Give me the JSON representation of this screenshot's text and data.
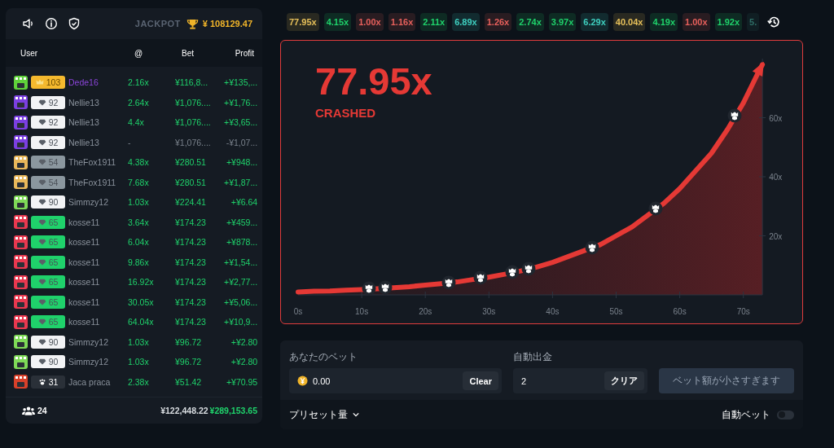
{
  "header": {
    "jackpot_label": "JACKPOT",
    "jackpot_amount": "¥ 108129.47"
  },
  "table": {
    "columns": [
      "User",
      "@",
      "Bet",
      "Profit"
    ],
    "rows": [
      {
        "avatar": {
          "color": "#5fd13a"
        },
        "badge": {
          "kind": "crown",
          "color": "#f5b92e",
          "level": "103"
        },
        "user": "Dede16",
        "highlight": true,
        "cashed_out": true,
        "at": "2.16x",
        "bet": "¥116,8...",
        "profit": "+¥135,..."
      },
      {
        "avatar": {
          "color": "#7b3fe0"
        },
        "badge": {
          "kind": "diamond",
          "color": "#f2f3f5",
          "level": "92"
        },
        "user": "Nellie13",
        "highlight": false,
        "cashed_out": true,
        "at": "2.64x",
        "bet": "¥1,076....",
        "profit": "+¥1,76..."
      },
      {
        "avatar": {
          "color": "#7b3fe0"
        },
        "badge": {
          "kind": "diamond",
          "color": "#f2f3f5",
          "level": "92"
        },
        "user": "Nellie13",
        "highlight": false,
        "cashed_out": true,
        "at": "4.4x",
        "bet": "¥1,076....",
        "profit": "+¥3,65..."
      },
      {
        "avatar": {
          "color": "#7b3fe0"
        },
        "badge": {
          "kind": "diamond",
          "color": "#f2f3f5",
          "level": "92"
        },
        "user": "Nellie13",
        "highlight": false,
        "cashed_out": false,
        "at": "-",
        "bet": "¥1,076....",
        "profit": "-¥1,07..."
      },
      {
        "avatar": {
          "color": "#e8b75a"
        },
        "badge": {
          "kind": "diamond",
          "color": "#8b979f",
          "level": "54"
        },
        "user": "TheFox1911",
        "highlight": false,
        "cashed_out": true,
        "at": "4.38x",
        "bet": "¥280.51",
        "profit": "+¥948..."
      },
      {
        "avatar": {
          "color": "#e8b75a"
        },
        "badge": {
          "kind": "diamond",
          "color": "#8b979f",
          "level": "54"
        },
        "user": "TheFox1911",
        "highlight": false,
        "cashed_out": true,
        "at": "7.68x",
        "bet": "¥280.51",
        "profit": "+¥1,87..."
      },
      {
        "avatar": {
          "color": "#7ed957"
        },
        "badge": {
          "kind": "diamond",
          "color": "#f2f3f5",
          "level": "90"
        },
        "user": "Simmzy12",
        "highlight": false,
        "cashed_out": true,
        "at": "1.03x",
        "bet": "¥224.41",
        "profit": "+¥6.64"
      },
      {
        "avatar": {
          "color": "#e8384f"
        },
        "badge": {
          "kind": "diamond",
          "color": "#1fd26b",
          "level": "65"
        },
        "user": "kosse11",
        "highlight": false,
        "cashed_out": true,
        "at": "3.64x",
        "bet": "¥174.23",
        "profit": "+¥459..."
      },
      {
        "avatar": {
          "color": "#e8384f"
        },
        "badge": {
          "kind": "diamond",
          "color": "#1fd26b",
          "level": "65"
        },
        "user": "kosse11",
        "highlight": false,
        "cashed_out": true,
        "at": "6.04x",
        "bet": "¥174.23",
        "profit": "+¥878..."
      },
      {
        "avatar": {
          "color": "#e8384f"
        },
        "badge": {
          "kind": "diamond",
          "color": "#1fd26b",
          "level": "65"
        },
        "user": "kosse11",
        "highlight": false,
        "cashed_out": true,
        "at": "9.86x",
        "bet": "¥174.23",
        "profit": "+¥1,54..."
      },
      {
        "avatar": {
          "color": "#e8384f"
        },
        "badge": {
          "kind": "diamond",
          "color": "#1fd26b",
          "level": "65"
        },
        "user": "kosse11",
        "highlight": false,
        "cashed_out": true,
        "at": "16.92x",
        "bet": "¥174.23",
        "profit": "+¥2,77..."
      },
      {
        "avatar": {
          "color": "#e8384f"
        },
        "badge": {
          "kind": "diamond",
          "color": "#1fd26b",
          "level": "65"
        },
        "user": "kosse11",
        "highlight": false,
        "cashed_out": true,
        "at": "30.05x",
        "bet": "¥174.23",
        "profit": "+¥5,06..."
      },
      {
        "avatar": {
          "color": "#e8384f"
        },
        "badge": {
          "kind": "diamond",
          "color": "#1fd26b",
          "level": "65"
        },
        "user": "kosse11",
        "highlight": false,
        "cashed_out": true,
        "at": "64.04x",
        "bet": "¥174.23",
        "profit": "+¥10,9..."
      },
      {
        "avatar": {
          "color": "#7ed957"
        },
        "badge": {
          "kind": "diamond",
          "color": "#f2f3f5",
          "level": "90"
        },
        "user": "Simmzy12",
        "highlight": false,
        "cashed_out": true,
        "at": "1.03x",
        "bet": "¥96.72",
        "profit": "+¥2.80"
      },
      {
        "avatar": {
          "color": "#7ed957"
        },
        "badge": {
          "kind": "diamond",
          "color": "#f2f3f5",
          "level": "90"
        },
        "user": "Simmzy12",
        "highlight": false,
        "cashed_out": true,
        "at": "1.03x",
        "bet": "¥96.72",
        "profit": "+¥2.80"
      },
      {
        "avatar": {
          "color": "#d8402a"
        },
        "badge": {
          "kind": "paw",
          "color": "#2a3038",
          "level": "31"
        },
        "user": "Jaca praca",
        "highlight": false,
        "cashed_out": true,
        "at": "2.38x",
        "bet": "¥51.42",
        "profit": "+¥70.95"
      }
    ]
  },
  "footer": {
    "players": "24",
    "total_bet": "¥122,448.22",
    "total_profit": "¥289,153.65"
  },
  "history": [
    {
      "value": "77.95x",
      "color": "#e8c15a"
    },
    {
      "value": "4.15x",
      "color": "#1fd26b"
    },
    {
      "value": "1.00x",
      "color": "#e8605c"
    },
    {
      "value": "1.16x",
      "color": "#e8605c"
    },
    {
      "value": "2.11x",
      "color": "#1fd26b"
    },
    {
      "value": "6.89x",
      "color": "#3fd0c0"
    },
    {
      "value": "1.26x",
      "color": "#e8605c"
    },
    {
      "value": "2.74x",
      "color": "#1fd26b"
    },
    {
      "value": "3.97x",
      "color": "#1fd26b"
    },
    {
      "value": "6.29x",
      "color": "#3fd0c0"
    },
    {
      "value": "40.04x",
      "color": "#e8c15a"
    },
    {
      "value": "4.19x",
      "color": "#1fd26b"
    },
    {
      "value": "1.00x",
      "color": "#e8605c"
    },
    {
      "value": "1.92x",
      "color": "#1fd26b"
    },
    {
      "value": "5.",
      "color": "#2e6e66"
    }
  ],
  "game": {
    "multiplier": "77.95x",
    "status": "CRASHED",
    "chart_data": {
      "type": "area",
      "x": [
        0,
        2.5,
        5,
        7.5,
        10,
        12.5,
        15,
        17.5,
        20,
        22.5,
        25,
        27.5,
        30,
        32.5,
        35,
        37.5,
        40,
        42.5,
        45,
        47.5,
        50,
        52.5,
        55,
        57.5,
        60,
        62.5,
        65,
        67.5,
        70,
        72.5,
        73
      ],
      "series": [
        {
          "color": "#e53935",
          "values": [
            1,
            1.2,
            1.3,
            1.6,
            1.8,
            2.1,
            2.4,
            2.8,
            3.3,
            3.8,
            4.4,
            5.2,
            6,
            7,
            8.1,
            9.4,
            11,
            13,
            15,
            17,
            20,
            23,
            27,
            31,
            36,
            42,
            48,
            56,
            65,
            76,
            78
          ]
        }
      ],
      "xlim": [
        0,
        73
      ],
      "ylim": [
        0,
        80
      ],
      "xticks": [
        {
          "value": 0,
          "label": "0s"
        },
        {
          "value": 10,
          "label": "10s"
        },
        {
          "value": 20,
          "label": "20s"
        },
        {
          "value": 30,
          "label": "30s"
        },
        {
          "value": 40,
          "label": "40s"
        },
        {
          "value": 50,
          "label": "50s"
        },
        {
          "value": 60,
          "label": "60s"
        },
        {
          "value": 70,
          "label": "70s"
        }
      ],
      "yticks": [
        {
          "value": 20,
          "label": "20x"
        },
        {
          "value": 40,
          "label": "40x"
        },
        {
          "value": 60,
          "label": "60x"
        }
      ]
    }
  },
  "bet": {
    "bet_label": "あなたのベット",
    "bet_value": "0.00",
    "bet_clear": "Clear",
    "auto_label": "自動出金",
    "auto_value": "2",
    "auto_clear": "クリア",
    "submit": "ベット額が小さすぎます",
    "submit_disabled": true,
    "preset": "プリセット量",
    "auto_bet_label": "自動ベット",
    "auto_bet_on": false
  }
}
